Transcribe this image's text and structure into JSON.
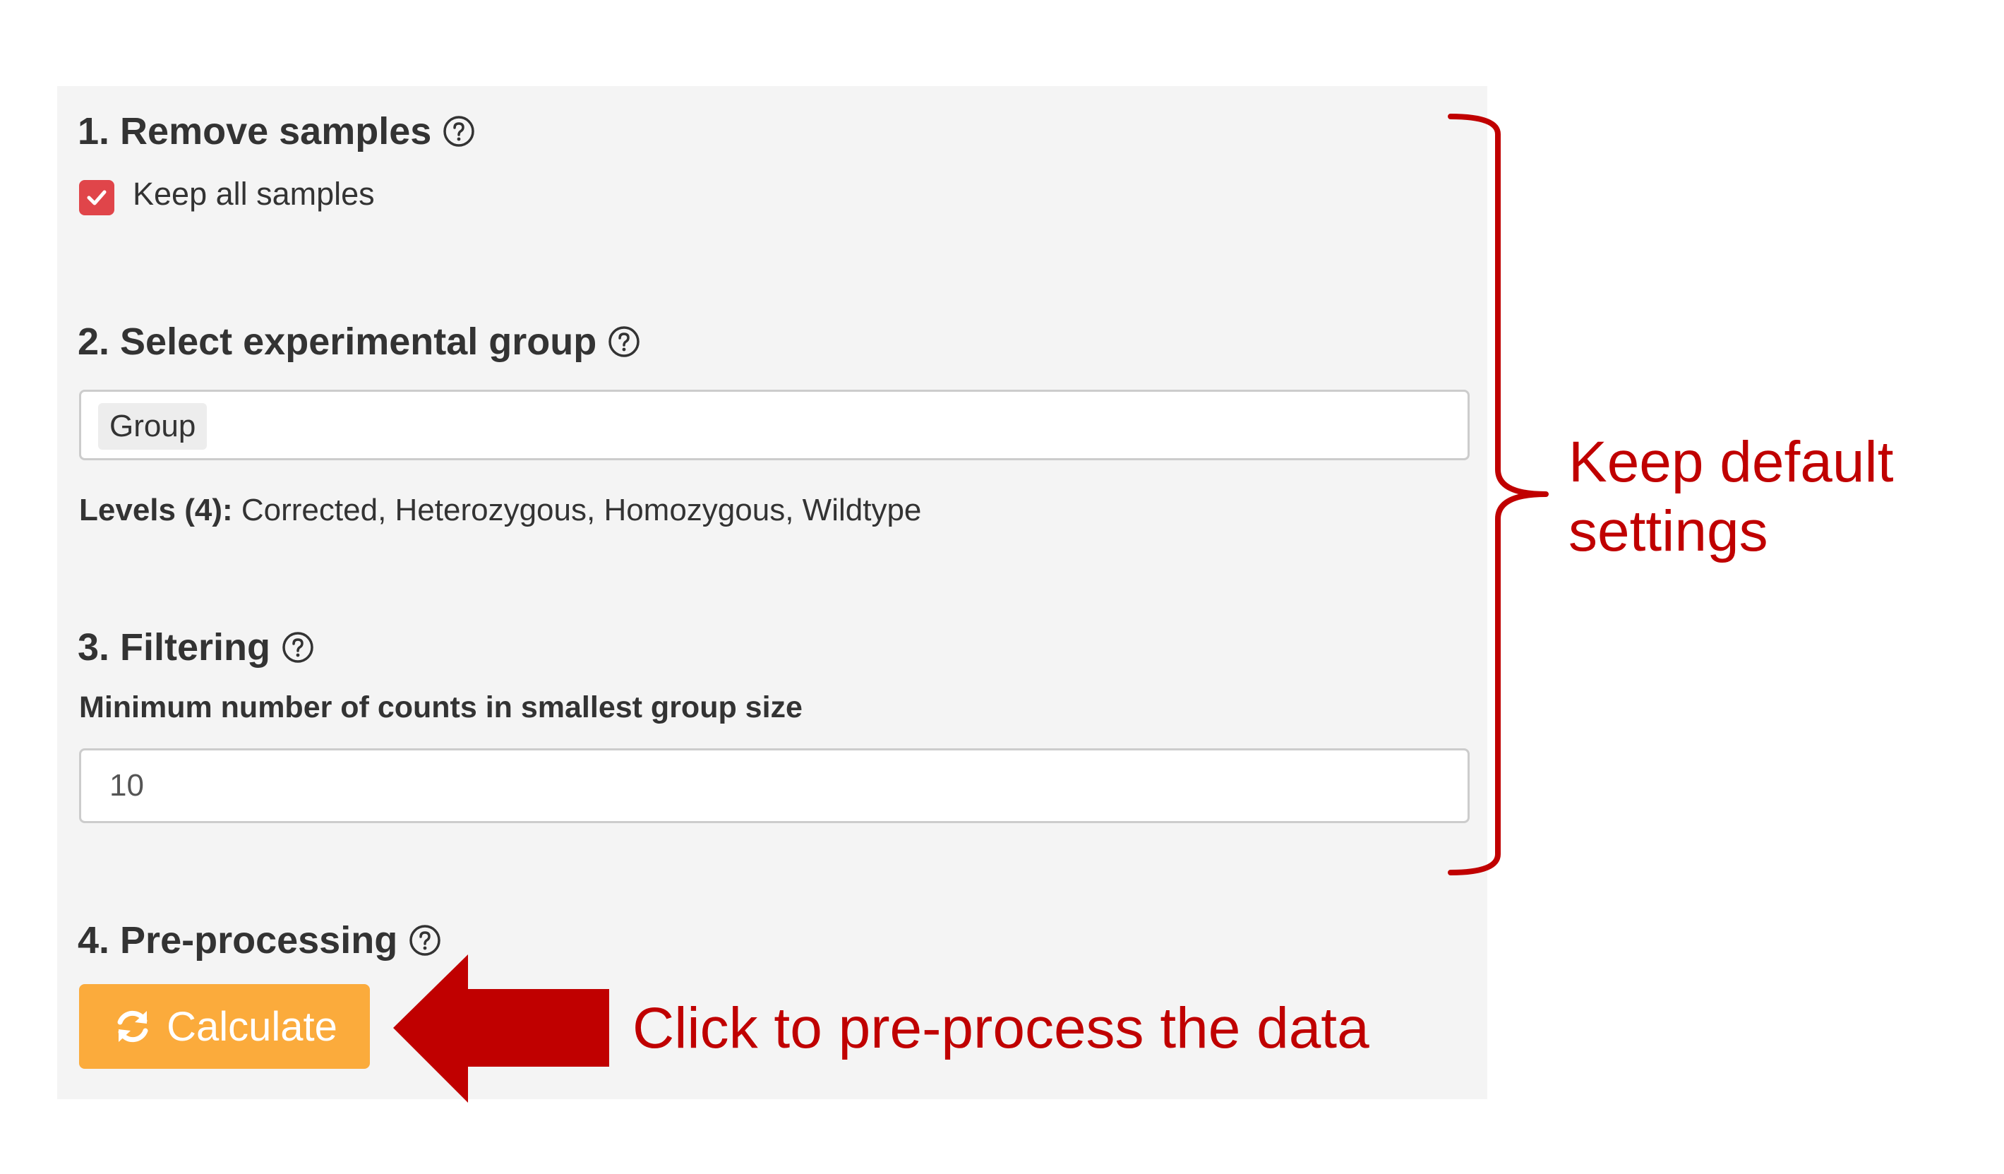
{
  "sections": {
    "remove_samples": {
      "heading": "1. Remove samples",
      "checkbox_label": "Keep all samples",
      "checked": true
    },
    "experimental_group": {
      "heading": "2. Select experimental group",
      "selected_value": "Group",
      "levels_label": "Levels (4):",
      "levels_values": "Corrected, Heterozygous, Homozygous, Wildtype"
    },
    "filtering": {
      "heading": "3. Filtering",
      "min_counts_label": "Minimum number of counts in smallest group size",
      "min_counts_value": "10"
    },
    "preprocessing": {
      "heading": "4. Pre-processing",
      "calculate_label": "Calculate"
    }
  },
  "annotations": {
    "keep_default": [
      "Keep default",
      "settings"
    ],
    "click_hint": "Click to pre-process the data"
  },
  "icons": {
    "help": "question-circle-icon",
    "check": "check-icon",
    "refresh": "refresh-icon"
  },
  "colors": {
    "panel_background": "#f4f4f4",
    "checkbox": "#e0454a",
    "button": "#fbab3c",
    "annotation": "#c00000"
  }
}
